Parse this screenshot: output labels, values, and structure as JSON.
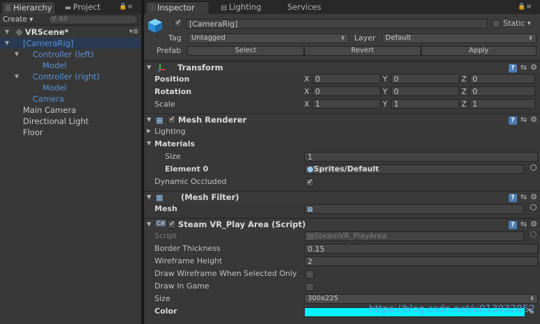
{
  "hierarchy": {
    "tabs": [
      {
        "label": "Hierarchy",
        "icon": "list-icon"
      },
      {
        "label": "Project",
        "icon": "folder-icon"
      }
    ],
    "create_label": "Create ▾",
    "search_placeholder": "All",
    "scene": "VRScene*",
    "items": [
      {
        "label": "[CameraRig]",
        "depth": 1,
        "blue": true,
        "selected": true,
        "expanded": true
      },
      {
        "label": "Controller (left)",
        "depth": 2,
        "blue": true,
        "expanded": true
      },
      {
        "label": "Model",
        "depth": 3,
        "blue": true
      },
      {
        "label": "Controller (right)",
        "depth": 2,
        "blue": true,
        "expanded": true
      },
      {
        "label": "Model",
        "depth": 3,
        "blue": true
      },
      {
        "label": "Camera",
        "depth": 2,
        "blue": true
      },
      {
        "label": "Main Camera",
        "depth": 1
      },
      {
        "label": "Directional Light",
        "depth": 1
      },
      {
        "label": "Floor",
        "depth": 1
      }
    ]
  },
  "inspector": {
    "tabs": [
      {
        "label": "Inspector",
        "icon": "info-icon"
      },
      {
        "label": "Lighting",
        "icon": "lighting-icon"
      },
      {
        "label": "Services",
        "icon": ""
      }
    ],
    "object_name": "[CameraRig]",
    "static_label": "Static",
    "tag_label": "Tag",
    "tag_value": "Untagged",
    "layer_label": "Layer",
    "layer_value": "Default",
    "prefab_label": "Prefab",
    "prefab_buttons": [
      "Select",
      "Revert",
      "Apply"
    ],
    "transform": {
      "title": "Transform",
      "position_label": "Position",
      "rotation_label": "Rotation",
      "scale_label": "Scale",
      "axes": [
        "X",
        "Y",
        "Z"
      ],
      "position": [
        "0",
        "0",
        "0"
      ],
      "rotation": [
        "0",
        "0",
        "0"
      ],
      "scale": [
        "1",
        "1",
        "1"
      ]
    },
    "mesh_renderer": {
      "title": "Mesh Renderer",
      "lighting_label": "Lighting",
      "materials_label": "Materials",
      "size_label": "Size",
      "size_value": "1",
      "element0_label": "Element 0",
      "element0_value": "Sprites/Default",
      "dynamic_occluded_label": "Dynamic Occluded"
    },
    "mesh_filter": {
      "title": "(Mesh Filter)",
      "mesh_label": "Mesh"
    },
    "play_area": {
      "title": "Steam VR_Play Area (Script)",
      "script_label": "Script",
      "script_value": "SteamVR_PlayArea",
      "border_label": "Border Thickness",
      "border_value": "0.15",
      "wireframe_label": "Wireframe Height",
      "wireframe_value": "2",
      "draw_selected_label": "Draw Wireframe When Selected Only",
      "draw_in_game_label": "Draw In Game",
      "size_label": "Size",
      "size_value": "300x225",
      "color_label": "Color",
      "color_value": "#00F0FF"
    },
    "watermark": "https://blog.csdn.net/u013032852"
  }
}
